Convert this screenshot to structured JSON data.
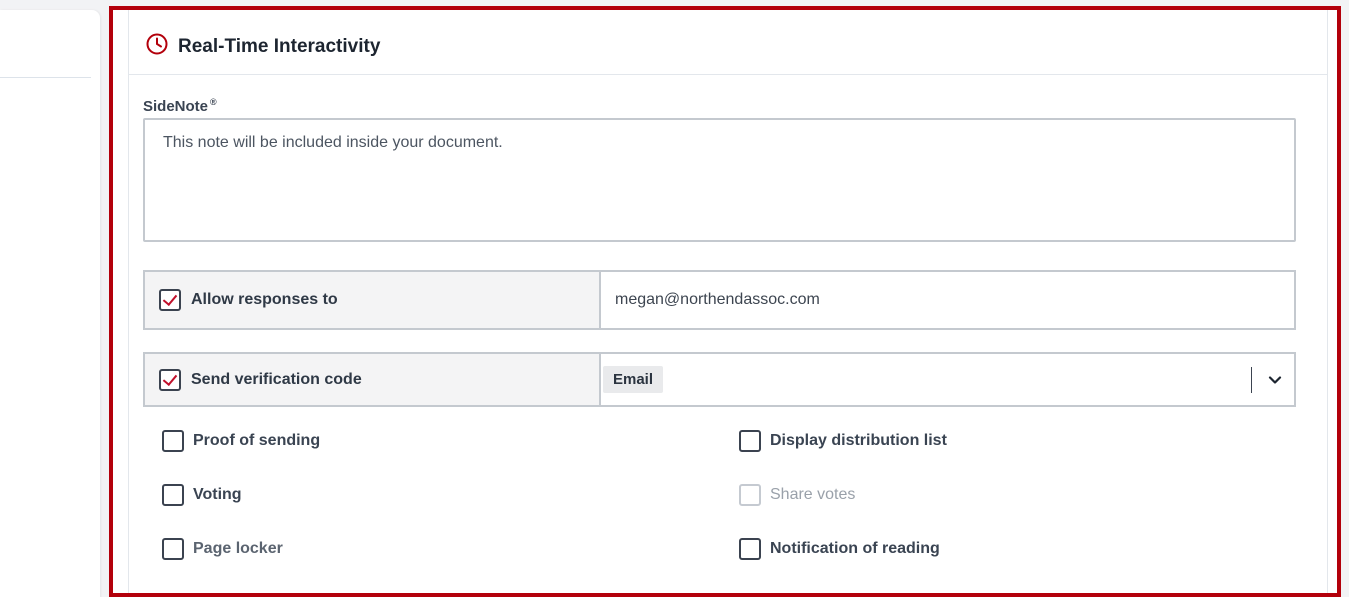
{
  "section": {
    "title": "Real-Time Interactivity",
    "icon": "clock-icon",
    "accent_color": "#b3000b"
  },
  "sidenote": {
    "label": "SideNote",
    "label_mark": "®",
    "placeholder": "This note will be included inside your document."
  },
  "responses": {
    "label": "Allow responses to",
    "checked": true,
    "value": "megan@northendassoc.com"
  },
  "verification": {
    "label": "Send verification code",
    "checked": true,
    "selected": "Email"
  },
  "options": {
    "proof_of_sending": {
      "label": "Proof of sending",
      "checked": false
    },
    "display_distribution_list": {
      "label": "Display distribution list",
      "checked": false
    },
    "voting": {
      "label": "Voting",
      "checked": false
    },
    "share_votes": {
      "label": "Share votes",
      "checked": false,
      "disabled": true
    },
    "page_locker": {
      "label": "Page locker",
      "checked": false
    },
    "notification_of_reading": {
      "label": "Notification of reading",
      "checked": false
    }
  }
}
